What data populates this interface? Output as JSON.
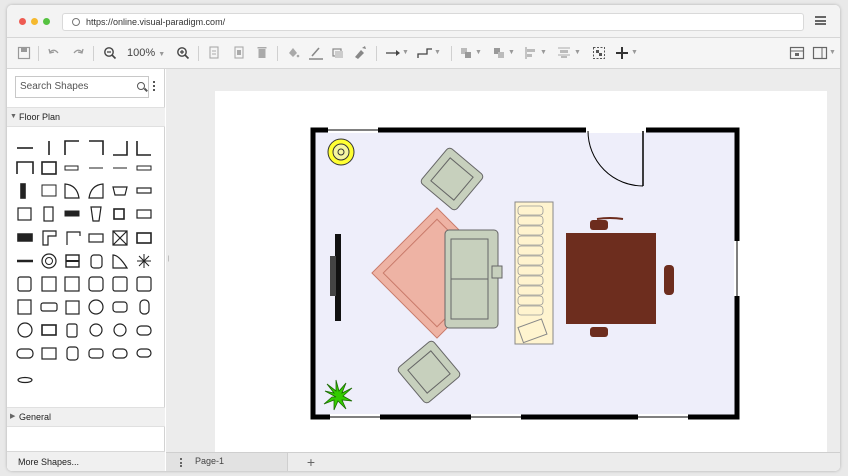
{
  "browser": {
    "url": "https://online.visual-paradigm.com/",
    "traffic_lights": [
      "#ee5b52",
      "#f5b92f",
      "#55c240"
    ]
  },
  "toolbar": {
    "zoom_level": "100%",
    "icons": [
      "save-icon",
      "undo-icon",
      "redo-icon",
      "zoom-out-icon",
      "zoom-in-icon",
      "copy-icon",
      "paste-icon",
      "delete-icon",
      "fill-color-icon",
      "line-color-icon",
      "shadow-icon",
      "format-painter-icon",
      "connector-icon",
      "waypoint-icon",
      "to-front-icon",
      "to-back-icon",
      "align-icon",
      "distribute-icon",
      "group-icon",
      "add-icon",
      "format-panel-icon",
      "outline-panel-icon"
    ]
  },
  "sidebar": {
    "search_placeholder": "Search Shapes",
    "sections": [
      {
        "label": "Floor Plan",
        "expanded": true
      },
      {
        "label": "General",
        "expanded": false
      }
    ],
    "more_shapes_label": "More Shapes..."
  },
  "pages": {
    "tabs": [
      {
        "label": "Page-1",
        "active": true
      }
    ]
  },
  "floorplan": {
    "wall_color": "#000000",
    "floor_color": "#eeeefa",
    "rug_color": "#eeb3a4",
    "sofa_color": "#c7d0bd",
    "table_color": "#6d2d1e",
    "lamp_color": "#ffff33",
    "plant_color": "#33cc00",
    "shelf_color": "#fff4cf"
  }
}
